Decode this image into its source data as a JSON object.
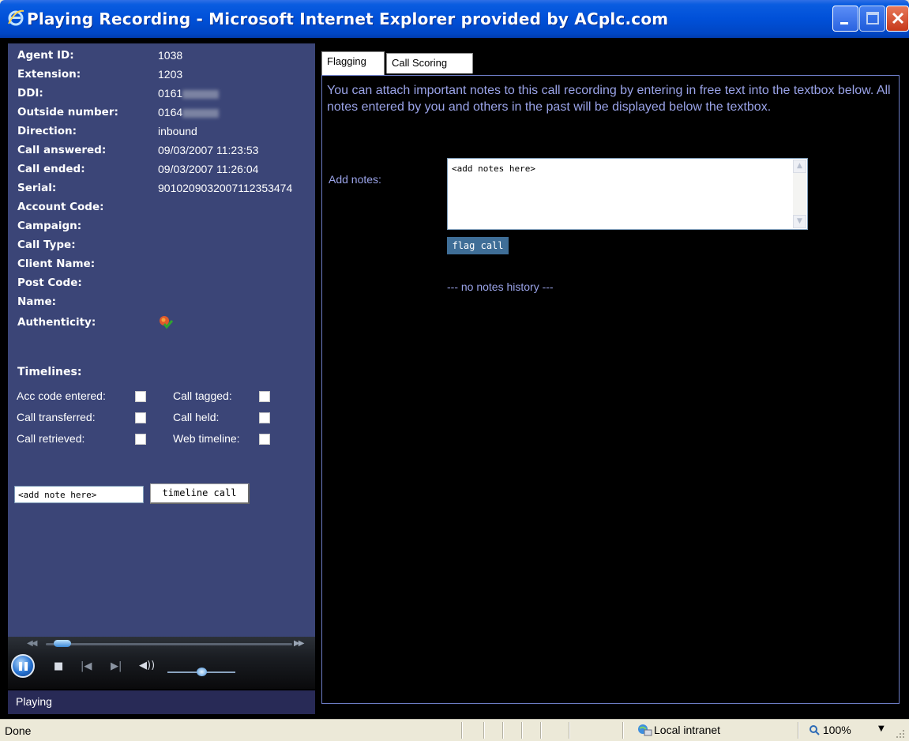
{
  "window": {
    "title": "Playing Recording - Microsoft Internet Explorer provided by ACplc.com",
    "icon": "ie-icon"
  },
  "call_info": [
    {
      "label": "Agent ID:",
      "value": "1038"
    },
    {
      "label": "Extension:",
      "value": "1203"
    },
    {
      "label": "DDI:",
      "value": "0161"
    },
    {
      "label": "Outside number:",
      "value": "0164"
    },
    {
      "label": "Direction:",
      "value": "inbound"
    },
    {
      "label": "Call answered:",
      "value": "09/03/2007 11:23:53"
    },
    {
      "label": "Call ended:",
      "value": "09/03/2007 11:26:04"
    },
    {
      "label": "Serial:",
      "value": "9010209032007112353474"
    },
    {
      "label": "Account Code:",
      "value": ""
    },
    {
      "label": "Campaign:",
      "value": ""
    },
    {
      "label": "Call Type:",
      "value": ""
    },
    {
      "label": "Client Name:",
      "value": ""
    },
    {
      "label": "Post Code:",
      "value": ""
    },
    {
      "label": "Name:",
      "value": ""
    },
    {
      "label": "Authenticity:",
      "value": ""
    }
  ],
  "timelines": {
    "title": "Timelines:",
    "items": [
      {
        "label": "Acc code entered:",
        "checked": false
      },
      {
        "label": "Call tagged:",
        "checked": false
      },
      {
        "label": "Call transferred:",
        "checked": false
      },
      {
        "label": "Call held:",
        "checked": false
      },
      {
        "label": "Call retrieved:",
        "checked": false
      },
      {
        "label": "Web timeline:",
        "checked": false
      }
    ],
    "note_input_value": "<add note here>",
    "button_label": "timeline call"
  },
  "player": {
    "status": "Playing",
    "seek_progress": 0.05,
    "volume": 0.5
  },
  "tabs": [
    {
      "label": "Flagging",
      "active": true
    },
    {
      "label": "Call Scoring",
      "active": false
    }
  ],
  "flagging": {
    "intro": "You can attach important notes to this call recording by entering in free text into the textbox below. All notes entered by you and others in the past will be displayed below the textbox.",
    "notes_label": "Add notes:",
    "notes_value": "<add notes here>",
    "flag_button": "flag call",
    "history": "--- no notes history ---"
  },
  "statusbar": {
    "status": "Done",
    "zone": "Local intranet",
    "zoom": "100%"
  }
}
